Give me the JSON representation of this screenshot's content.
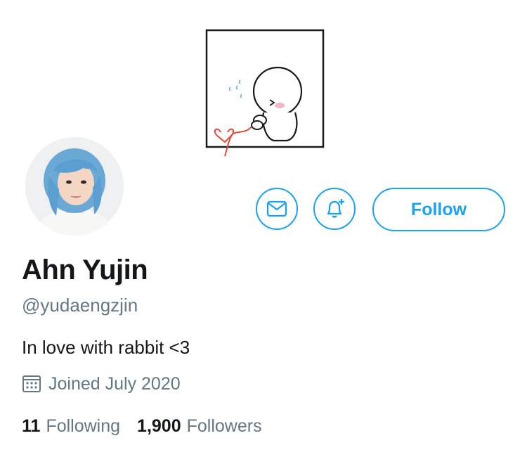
{
  "profile": {
    "name": "Ahn Yujin",
    "handle": "@yudaengzjin",
    "bio": "In love with rabbit <3",
    "joined": "Joined July 2020",
    "following_count": "11",
    "following_label": "Following",
    "followers_count": "1,900",
    "followers_label": "Followers"
  },
  "actions": {
    "message_icon": "envelope-icon",
    "notify_icon": "bell-plus-icon",
    "follow_label": "Follow"
  },
  "colors": {
    "accent": "#1da1f2",
    "secondary_text": "#657786",
    "primary_text": "#14171a"
  }
}
